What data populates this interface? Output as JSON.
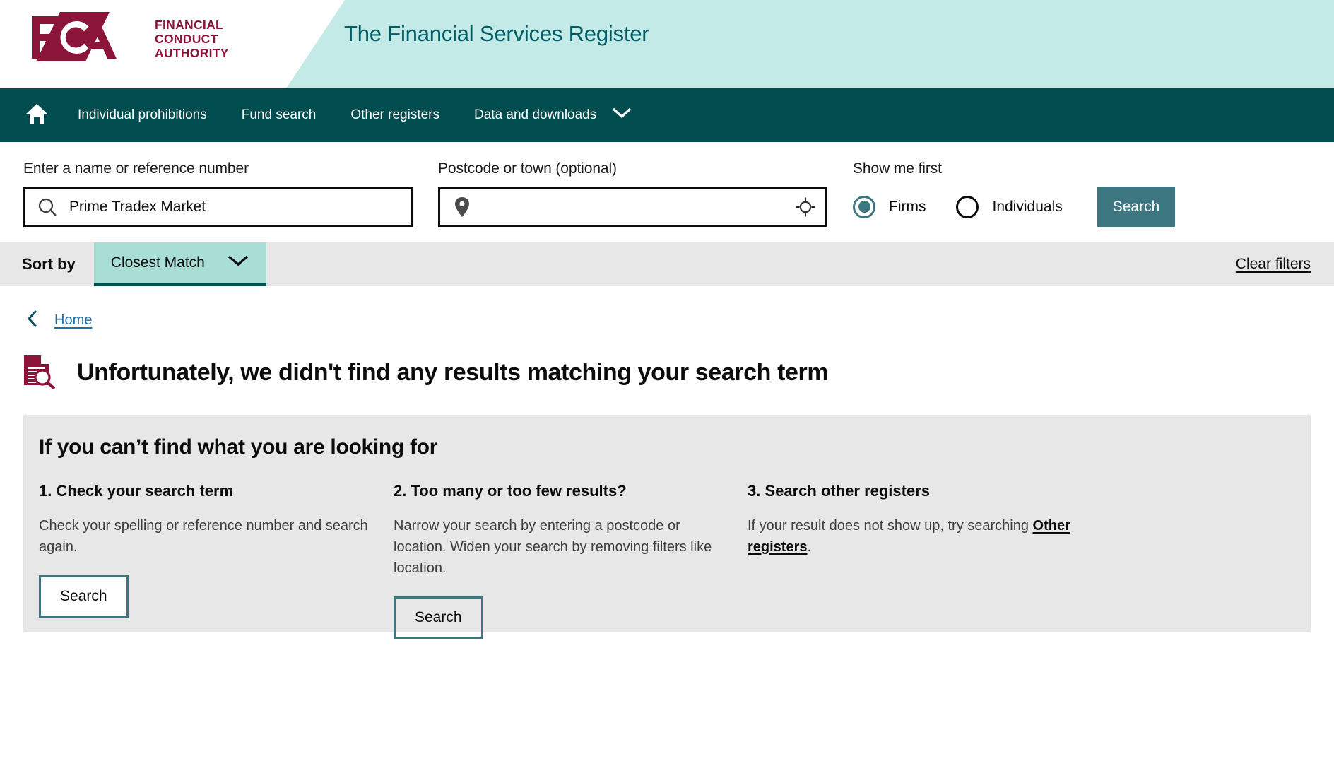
{
  "brand": {
    "logo_letters": "FCA",
    "logo_words": [
      "FINANCIAL",
      "CONDUCT",
      "AUTHORITY"
    ],
    "register_title": "The Financial Services Register",
    "accent_maroon": "#8a1538",
    "accent_teal": "#014c4e",
    "accent_light_teal": "#c3eae6"
  },
  "nav": {
    "home_icon": "home-icon",
    "items": [
      {
        "label": "Individual prohibitions"
      },
      {
        "label": "Fund search"
      },
      {
        "label": "Other registers"
      },
      {
        "label": "Data and downloads",
        "caret": "chevron-down-icon"
      }
    ]
  },
  "search": {
    "name_label": "Enter a name or reference number",
    "name_value": "Prime Tradex Market",
    "name_icon": "search-icon",
    "postcode_label": "Postcode or town (optional)",
    "postcode_value": "",
    "postcode_placeholder": "",
    "postcode_icon": "location-pin-icon",
    "geolocate_icon": "crosshair-icon",
    "show_me_first_label": "Show me first",
    "options": [
      {
        "label": "Firms",
        "selected": true
      },
      {
        "label": "Individuals",
        "selected": false
      }
    ],
    "search_button": "Search",
    "search_button_color": "#3c7680"
  },
  "sortbar": {
    "sort_by_label": "Sort by",
    "sort_value": "Closest Match",
    "sort_caret": "chevron-down-icon",
    "clear_filters": "Clear filters"
  },
  "breadcrumb": {
    "back_icon": "chevron-left-icon",
    "home_label": "Home"
  },
  "results": {
    "icon": "document-search-icon",
    "no_results_title": "Unfortunately, we didn't find any results matching your search term"
  },
  "help": {
    "heading": "If you can’t find what you are looking for",
    "columns": [
      {
        "title": "1. Check your search term",
        "text": "Check your spelling or reference number and search again.",
        "button": "Search"
      },
      {
        "title": "2. Too many or too few results?",
        "text": "Narrow your search by entering a postcode or location. Widen your search by removing filters like location.",
        "button": "Search"
      },
      {
        "title": "3. Search other registers",
        "text_before": "If your result does not show up, try searching ",
        "link": "Other registers",
        "text_after": "."
      }
    ]
  }
}
